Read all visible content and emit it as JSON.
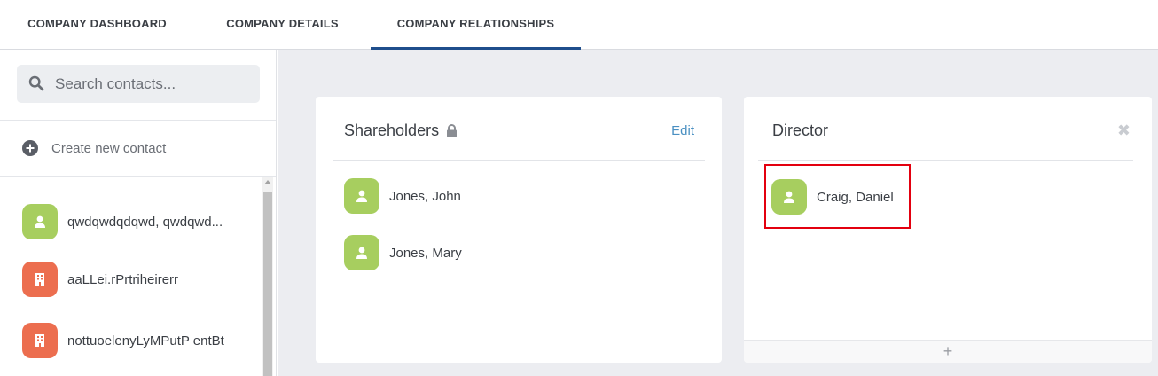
{
  "tabs": [
    {
      "label": "COMPANY DASHBOARD",
      "active": false
    },
    {
      "label": "COMPANY DETAILS",
      "active": false
    },
    {
      "label": "COMPANY RELATIONSHIPS",
      "active": true
    }
  ],
  "sidebar": {
    "search_placeholder": "Search contacts...",
    "search_value": "",
    "create_label": "Create new contact",
    "contacts": [
      {
        "name": "qwdqwdqdqwd, qwdqwd...",
        "type": "person",
        "icon": "person-icon"
      },
      {
        "name": "aaLLei.rPrtriheirerr",
        "type": "company",
        "icon": "building-icon"
      },
      {
        "name": "nottuoelenyLyMPutP entBt",
        "type": "company",
        "icon": "building-icon"
      }
    ]
  },
  "shareholders": {
    "title": "Shareholders",
    "edit_label": "Edit",
    "members": [
      {
        "name": "Jones, John",
        "icon": "person-icon"
      },
      {
        "name": "Jones, Mary",
        "icon": "person-icon"
      }
    ]
  },
  "director": {
    "title": "Director",
    "close_label": "✖",
    "add_label": "+",
    "members": [
      {
        "name": "Craig, Daniel",
        "icon": "person-icon",
        "highlighted": true
      }
    ]
  },
  "colors": {
    "person_avatar": "#a7ce5f",
    "company_avatar": "#ec6e4f",
    "active_tab_underline": "#1f4e8c",
    "link": "#4a90c2",
    "highlight_border": "#e3000f"
  }
}
